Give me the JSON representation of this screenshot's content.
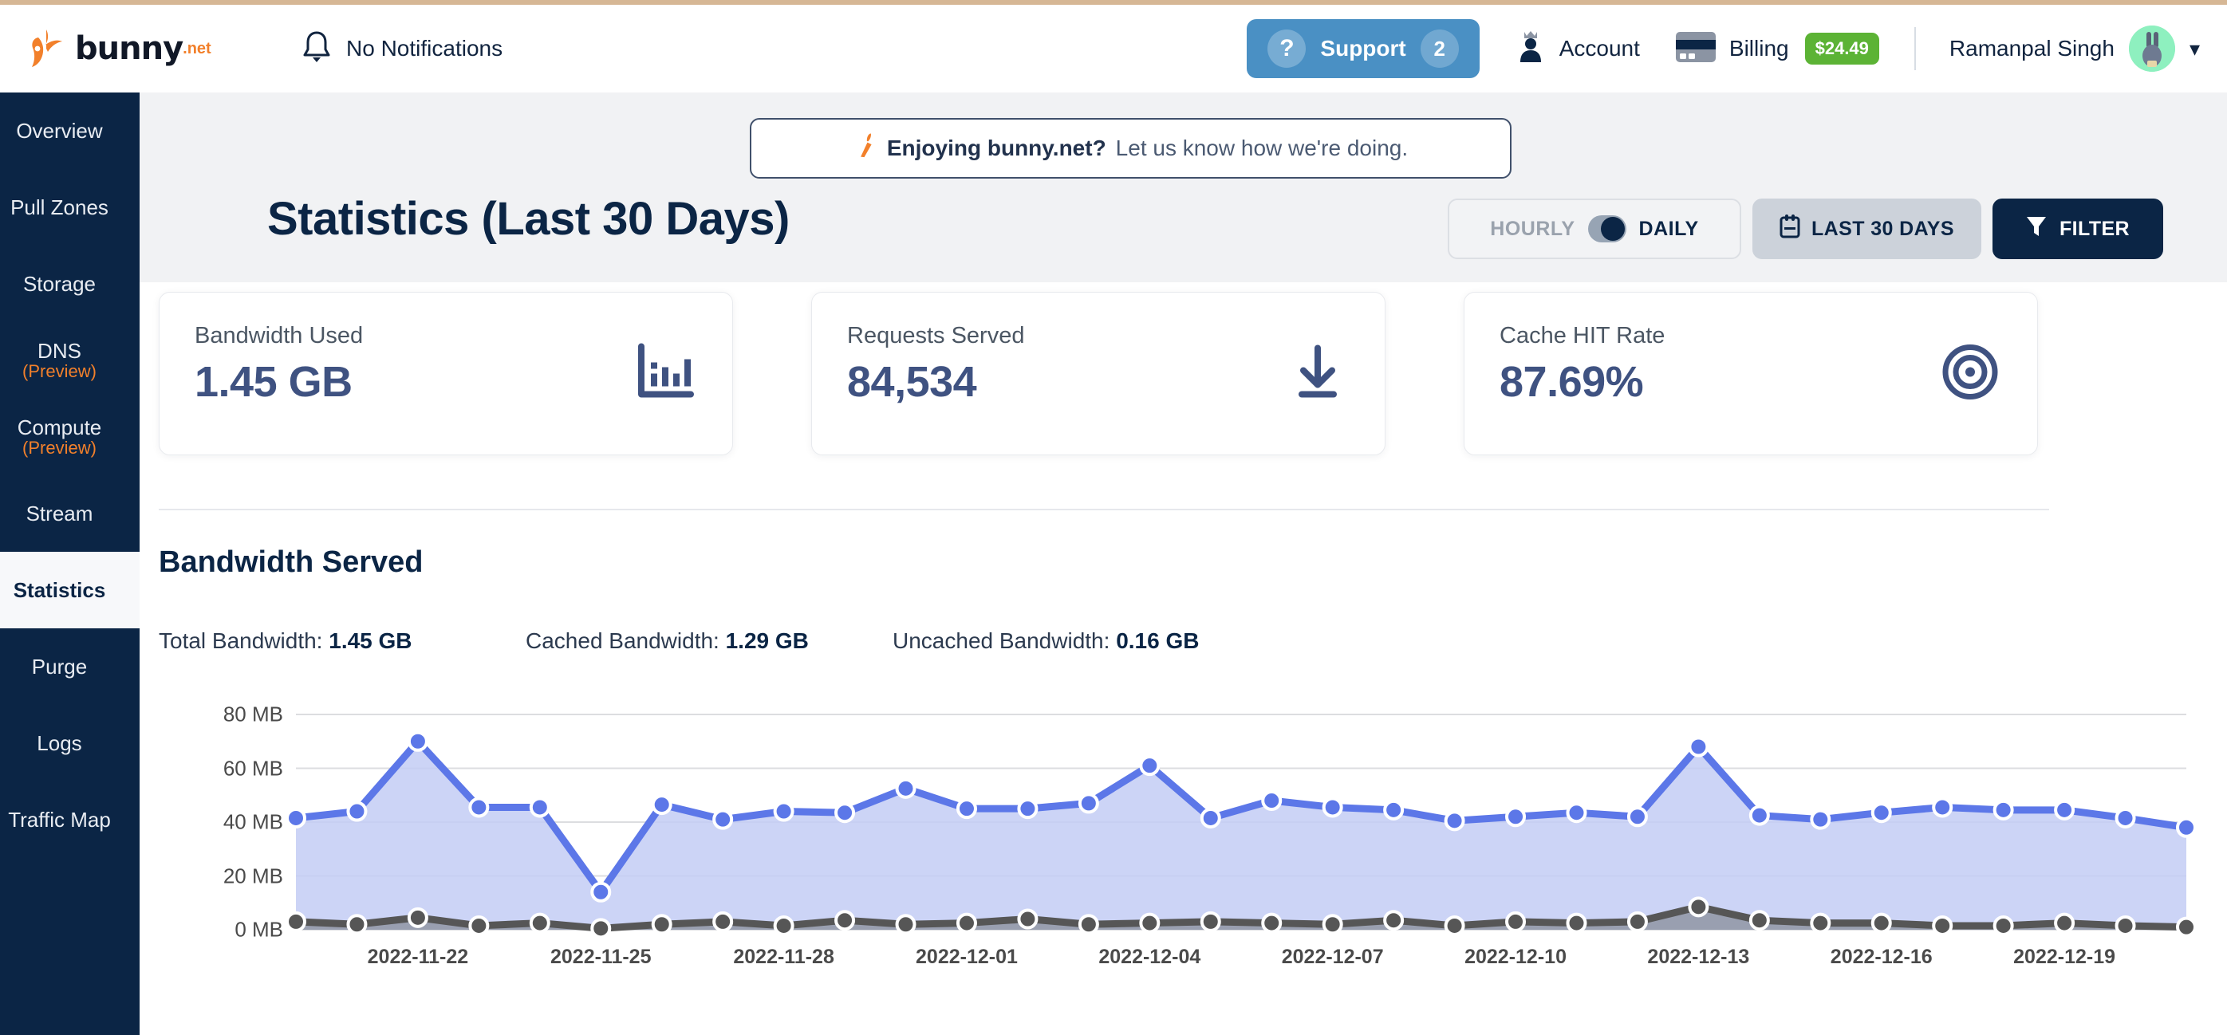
{
  "brand": {
    "name": "bunny",
    "suffix": ".net",
    "logo_icon": "bunny-logo-icon"
  },
  "topbar": {
    "notifications_label": "No Notifications",
    "notification_icon": "bell-icon",
    "support": {
      "label": "Support",
      "count": "2",
      "icon": "question-mark-icon"
    },
    "account": {
      "label": "Account",
      "icon": "person-crown-icon"
    },
    "billing": {
      "label": "Billing",
      "amount": "$24.49",
      "icon": "credit-card-icon"
    },
    "user": {
      "name": "Ramanpal Singh",
      "avatar_icon": "bunny-avatar-icon",
      "chevron_icon": "chevron-down-icon"
    }
  },
  "sidebar": {
    "items": [
      {
        "label": "Overview",
        "sub": "",
        "active": false
      },
      {
        "label": "Pull Zones",
        "sub": "",
        "active": false
      },
      {
        "label": "Storage",
        "sub": "",
        "active": false
      },
      {
        "label": "DNS",
        "sub": "(Preview)",
        "active": false
      },
      {
        "label": "Compute",
        "sub": "(Preview)",
        "active": false
      },
      {
        "label": "Stream",
        "sub": "",
        "active": false
      },
      {
        "label": "Statistics",
        "sub": "",
        "active": true
      },
      {
        "label": "Purge",
        "sub": "",
        "active": false
      },
      {
        "label": "Logs",
        "sub": "",
        "active": false
      },
      {
        "label": "Traffic Map",
        "sub": "",
        "active": false
      }
    ]
  },
  "promo": {
    "icon": "carrot-icon",
    "bold_text": "Enjoying bunny.net?",
    "normal_text": "Let us know how we're doing."
  },
  "page": {
    "title": "Statistics (Last 30 Days)"
  },
  "toolbar": {
    "granularity": {
      "off_label": "HOURLY",
      "on_label": "DAILY",
      "selected": "DAILY",
      "toggle_icon": "toggle-switch-icon"
    },
    "date_range": {
      "label": "LAST 30 DAYS",
      "icon": "calendar-icon"
    },
    "filter": {
      "label": "FILTER",
      "icon": "funnel-icon"
    }
  },
  "cards": [
    {
      "label": "Bandwidth Used",
      "value": "1.45 GB",
      "icon": "bar-chart-icon"
    },
    {
      "label": "Requests Served",
      "value": "84,534",
      "icon": "download-arrow-icon"
    },
    {
      "label": "Cache HIT Rate",
      "value": "87.69%",
      "icon": "target-icon"
    }
  ],
  "section": {
    "title": "Bandwidth Served",
    "legend": [
      {
        "label": "Total Bandwidth:",
        "value": "1.45 GB"
      },
      {
        "label": "Cached Bandwidth:",
        "value": "1.29 GB"
      },
      {
        "label": "Uncached Bandwidth:",
        "value": "0.16 GB"
      }
    ]
  },
  "chart_data": {
    "type": "area",
    "title": "Bandwidth Served",
    "xlabel": "",
    "ylabel": "",
    "ylim": [
      0,
      80
    ],
    "ytick_labels": [
      "0 MB",
      "20 MB",
      "40 MB",
      "60 MB",
      "80 MB"
    ],
    "yticks": [
      0,
      20,
      40,
      60,
      80
    ],
    "grid": true,
    "legend_position": "none",
    "x": [
      "2022-11-20",
      "2022-11-21",
      "2022-11-22",
      "2022-11-23",
      "2022-11-24",
      "2022-11-25",
      "2022-11-26",
      "2022-11-27",
      "2022-11-28",
      "2022-11-29",
      "2022-11-30",
      "2022-12-01",
      "2022-12-02",
      "2022-12-03",
      "2022-12-04",
      "2022-12-05",
      "2022-12-06",
      "2022-12-07",
      "2022-12-08",
      "2022-12-09",
      "2022-12-10",
      "2022-12-11",
      "2022-12-12",
      "2022-12-13",
      "2022-12-14",
      "2022-12-15",
      "2022-12-16",
      "2022-12-17",
      "2022-12-18",
      "2022-12-19",
      "2022-12-20"
    ],
    "xtick_labels": [
      "2022-11-22",
      "2022-11-25",
      "2022-11-28",
      "2022-12-01",
      "2022-12-04",
      "2022-12-07",
      "2022-12-10",
      "2022-12-13",
      "2022-12-16",
      "2022-12-19"
    ],
    "xtick_indices": [
      2,
      5,
      8,
      11,
      14,
      17,
      20,
      23,
      26,
      29
    ],
    "series": [
      {
        "name": "Total Bandwidth",
        "color": "#5c77e8",
        "fill": "#c3ccf5",
        "values": [
          41.5,
          44.0,
          70.0,
          45.5,
          45.5,
          14.0,
          46.5,
          41.0,
          44.0,
          43.5,
          52.5,
          45.0,
          45.0,
          47.0,
          61.0,
          41.5,
          48.0,
          45.5,
          44.5,
          40.5,
          42.0,
          43.5,
          42.0,
          68.0,
          42.5,
          41.0,
          43.5,
          45.5,
          44.5,
          44.5,
          41.5,
          38.0
        ]
      },
      {
        "name": "Uncached Bandwidth",
        "color": "#565656",
        "fill": "#8f95a3",
        "values": [
          3.0,
          2.0,
          4.5,
          1.5,
          2.5,
          0.5,
          2.0,
          3.0,
          1.5,
          3.5,
          2.0,
          2.5,
          4.0,
          2.0,
          2.5,
          3.0,
          2.5,
          2.0,
          3.5,
          1.5,
          3.0,
          2.5,
          3.0,
          8.5,
          3.5,
          2.5,
          2.5,
          1.5,
          1.5,
          2.5,
          1.5,
          1.0
        ]
      }
    ]
  },
  "colors": {
    "sidebar_bg": "#0b2545",
    "accent_orange": "#f2802b",
    "support_blue": "#4a90c4",
    "billing_green": "#5cb335",
    "card_value": "#3f5281",
    "series_total": "#5c77e8",
    "series_uncached": "#565656"
  }
}
